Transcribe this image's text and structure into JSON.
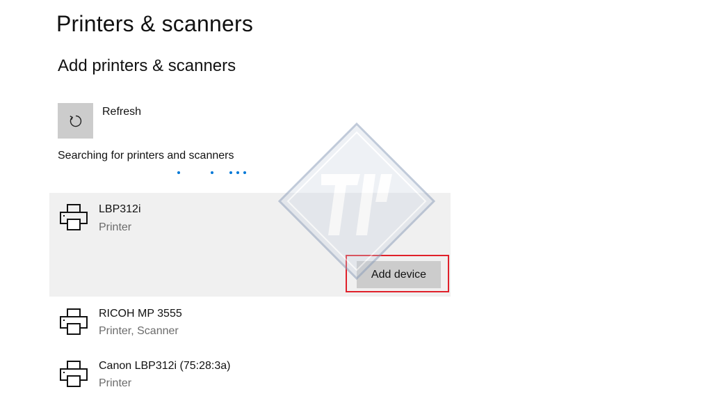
{
  "header": {
    "title": "Printers & scanners"
  },
  "add_section": {
    "title": "Add printers & scanners",
    "refresh_label": "Refresh",
    "search_status": "Searching for printers and scanners"
  },
  "devices": [
    {
      "name": "LBP312i",
      "type": "Printer",
      "selected": true
    },
    {
      "name": "RICOH MP 3555",
      "type": "Printer, Scanner"
    },
    {
      "name": "Canon LBP312i (75:28:3a)",
      "type": "Printer"
    }
  ],
  "add_device_label": "Add device",
  "icons": {
    "refresh": "refresh-icon",
    "printer": "printer-icon",
    "watermark": "watermark-logo"
  },
  "colors": {
    "accent": "#0078d7",
    "button_bg": "#cccccc",
    "selected_bg": "#f0f0f0",
    "highlight_border": "#e0202a",
    "secondary_text": "#6b6b6b"
  }
}
